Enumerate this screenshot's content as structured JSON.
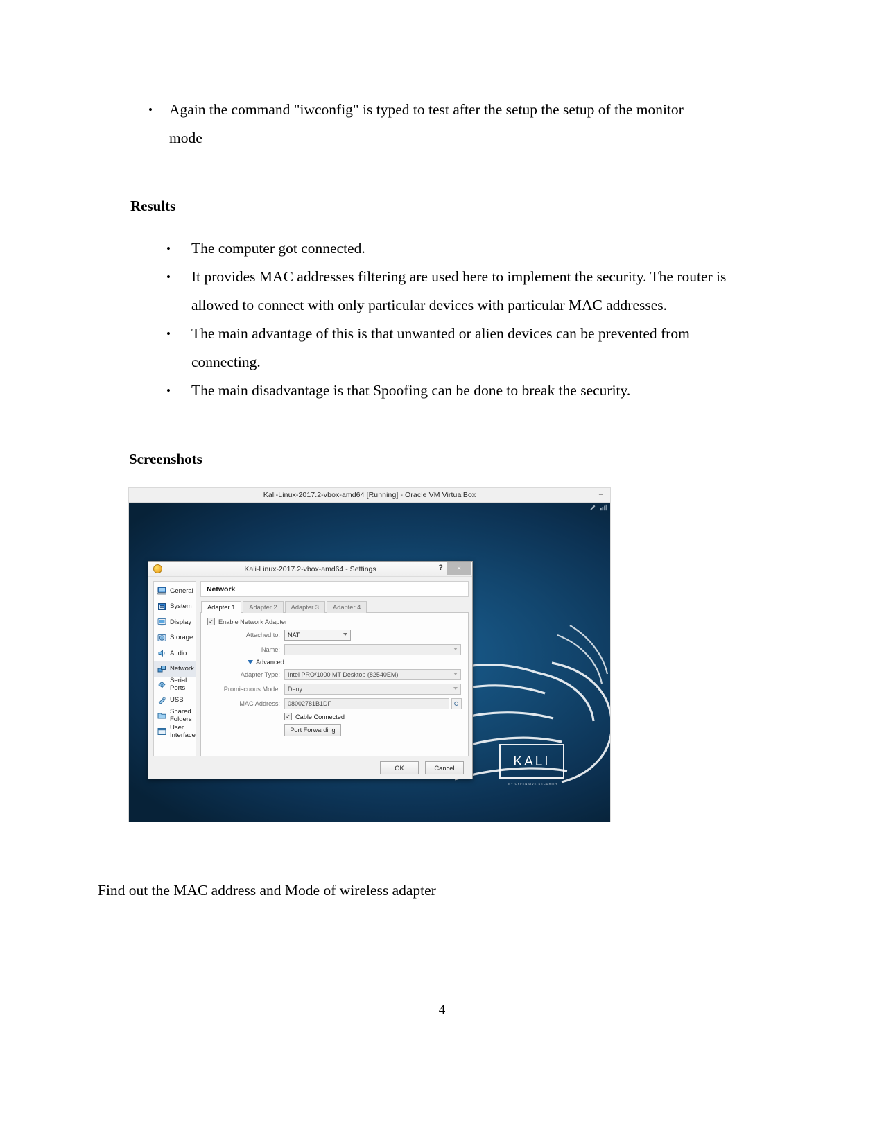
{
  "document": {
    "intro_bullet": "Again the command \"iwconfig\" is typed to test after the setup the setup of the monitor mode",
    "results_heading": "Results",
    "results_bullets": [
      "The computer got connected.",
      "It provides MAC addresses filtering are used here to implement the security. The router is allowed to connect with only particular devices with particular MAC addresses.",
      "The main advantage of this is that unwanted or alien devices can be prevented from connecting.",
      "The main disadvantage is that Spoofing can be done to break the security."
    ],
    "screenshots_heading": "Screenshots",
    "caption": "Find out the MAC address and Mode of wireless adapter",
    "page_number": "4",
    "bullet_glyph": "•"
  },
  "vbox": {
    "window_title": "Kali-Linux-2017.2-vbox-amd64 [Running] - Oracle VM VirtualBox",
    "minimize_glyph": "–",
    "desktop": {
      "logo_text": "KALI",
      "logo_subtitle": "BY OFFENSIVE SECURITY"
    },
    "dialog": {
      "title": "Kali-Linux-2017.2-vbox-amd64 - Settings",
      "help_label": "?",
      "close_label": "×",
      "sidebar": [
        {
          "label": "General",
          "icon": "monitor-icon",
          "selected": false
        },
        {
          "label": "System",
          "icon": "chip-icon",
          "selected": false
        },
        {
          "label": "Display",
          "icon": "display-icon",
          "selected": false
        },
        {
          "label": "Storage",
          "icon": "disk-icon",
          "selected": false
        },
        {
          "label": "Audio",
          "icon": "speaker-icon",
          "selected": false
        },
        {
          "label": "Network",
          "icon": "network-icon",
          "selected": true
        },
        {
          "label": "Serial Ports",
          "icon": "serial-port-icon",
          "selected": false
        },
        {
          "label": "USB",
          "icon": "usb-icon",
          "selected": false
        },
        {
          "label": "Shared Folders",
          "icon": "folder-icon",
          "selected": false
        },
        {
          "label": "User Interface",
          "icon": "window-icon",
          "selected": false
        }
      ],
      "panel_title": "Network",
      "tabs": [
        {
          "label": "Adapter 1",
          "active": true
        },
        {
          "label": "Adapter 2",
          "active": false
        },
        {
          "label": "Adapter 3",
          "active": false
        },
        {
          "label": "Adapter 4",
          "active": false
        }
      ],
      "enable_adapter": {
        "label": "Enable Network Adapter",
        "checked": true,
        "check_glyph": "✓"
      },
      "fields": {
        "attached_to_label": "Attached to:",
        "attached_to_value": "NAT",
        "name_label": "Name:",
        "name_value": "",
        "advanced_label": "Advanced",
        "adapter_type_label": "Adapter Type:",
        "adapter_type_value": "Intel PRO/1000 MT Desktop (82540EM)",
        "promiscuous_mode_label": "Promiscuous Mode:",
        "promiscuous_mode_value": "Deny",
        "mac_address_label": "MAC Address:",
        "mac_address_value": "08002781B1DF",
        "mac_refresh_icon": "refresh-icon"
      },
      "cable_connected": {
        "label": "Cable Connected",
        "checked": true,
        "check_glyph": "✓"
      },
      "port_forwarding_label": "Port Forwarding",
      "ok_label": "OK",
      "cancel_label": "Cancel"
    }
  }
}
